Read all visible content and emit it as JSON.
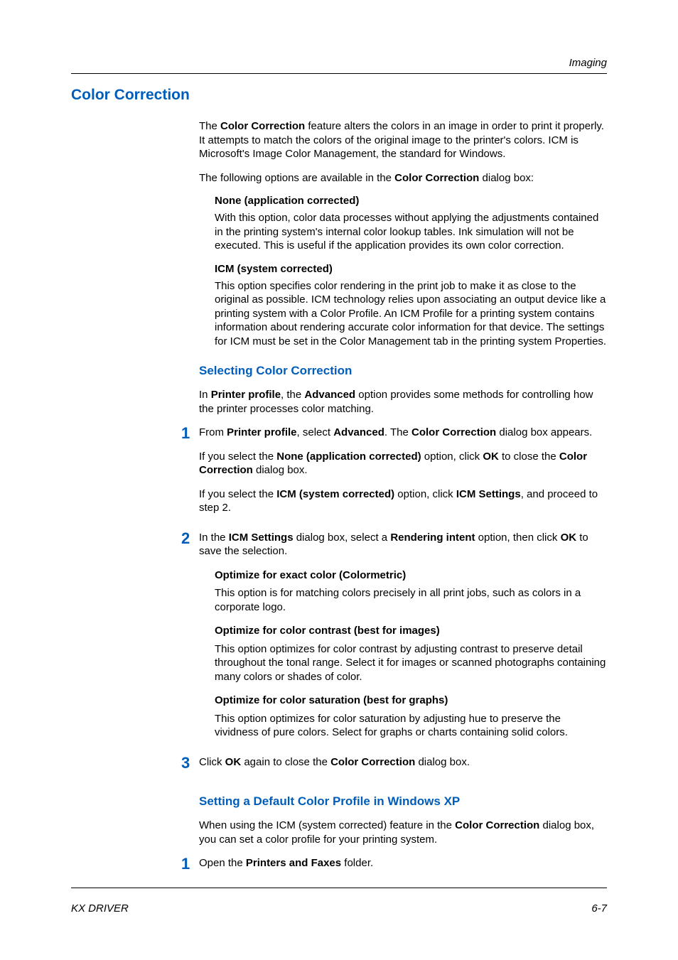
{
  "header": {
    "section": "Imaging"
  },
  "h1": "Color Correction",
  "intro": {
    "p1": {
      "t1": "The ",
      "b1": "Color Correction",
      "t2": " feature alters the colors in an image in order to print it properly. It attempts to match the colors of the original image to the printer's colors. ICM is Microsoft's Image Color Management, the standard for Windows."
    },
    "p2": {
      "t1": "The following options are available in the ",
      "b1": "Color Correction",
      "t2": " dialog box:"
    }
  },
  "defs": {
    "none": {
      "title": "None (application corrected)",
      "body": "With this option, color data processes without applying the adjustments contained in the printing system's internal color lookup tables. Ink simulation will not be executed. This is useful if the application provides its own color correction."
    },
    "icm": {
      "title": "ICM (system corrected)",
      "body": "This option specifies color rendering in the print job to make it as close to the original as possible. ICM technology relies upon associating an output device like a printing system with a Color Profile. An ICM Profile for a printing system contains information about rendering accurate color information for that device. The settings for ICM must be set in the Color Management tab in the printing system Properties."
    }
  },
  "sec1": {
    "title": "Selecting Color Correction",
    "intro": {
      "t1": "In ",
      "b1": "Printer profile",
      "t2": ", the ",
      "b2": "Advanced",
      "t3": " option provides some methods for controlling how the printer processes color matching."
    },
    "step1": {
      "num": "1",
      "p1": {
        "t1": "From ",
        "b1": "Printer profile",
        "t2": ", select ",
        "b2": "Advanced",
        "t3": ". The ",
        "b3": "Color Correction",
        "t4": " dialog box appears."
      },
      "p2": {
        "t1": "If you select the ",
        "b1": "None (application corrected)",
        "t2": " option, click ",
        "b2": "OK",
        "t3": " to close the ",
        "b3": "Color Correction",
        "t4": " dialog box."
      },
      "p3": {
        "t1": "If you select the ",
        "b1": "ICM (system corrected)",
        "t2": " option, click ",
        "b2": "ICM Settings",
        "t3": ", and proceed to step 2."
      }
    },
    "step2": {
      "num": "2",
      "p1": {
        "t1": "In the ",
        "b1": "ICM Settings",
        "t2": " dialog box, select a ",
        "b2": "Rendering intent",
        "t3": " option, then click ",
        "b3": "OK",
        "t4": " to save the selection."
      },
      "opt1": {
        "title": "Optimize for exact color (Colormetric)",
        "body": "This option is for matching colors precisely in all print jobs, such as colors in a corporate logo."
      },
      "opt2": {
        "title": "Optimize for color contrast (best for images)",
        "body": "This option optimizes for color contrast by adjusting contrast to preserve detail throughout the tonal range. Select it for images or scanned photographs containing many colors or shades of color."
      },
      "opt3": {
        "title": "Optimize for color saturation (best for graphs)",
        "body": "This option optimizes for color saturation by adjusting hue to preserve the vividness of pure colors. Select for graphs or charts containing solid colors."
      }
    },
    "step3": {
      "num": "3",
      "p1": {
        "t1": "Click ",
        "b1": "OK",
        "t2": " again to close the ",
        "b2": "Color Correction",
        "t3": " dialog box."
      }
    }
  },
  "sec2": {
    "title": "Setting a Default Color Profile in Windows XP",
    "intro": {
      "t1": "When using the ICM (system corrected) feature in the ",
      "b1": "Color Correction",
      "t2": " dialog box, you can set a color profile for your printing system."
    },
    "step1": {
      "num": "1",
      "p1": {
        "t1": "Open the ",
        "b1": "Printers and Faxes",
        "t2": " folder."
      }
    }
  },
  "footer": {
    "left": "KX DRIVER",
    "right": "6-7"
  }
}
